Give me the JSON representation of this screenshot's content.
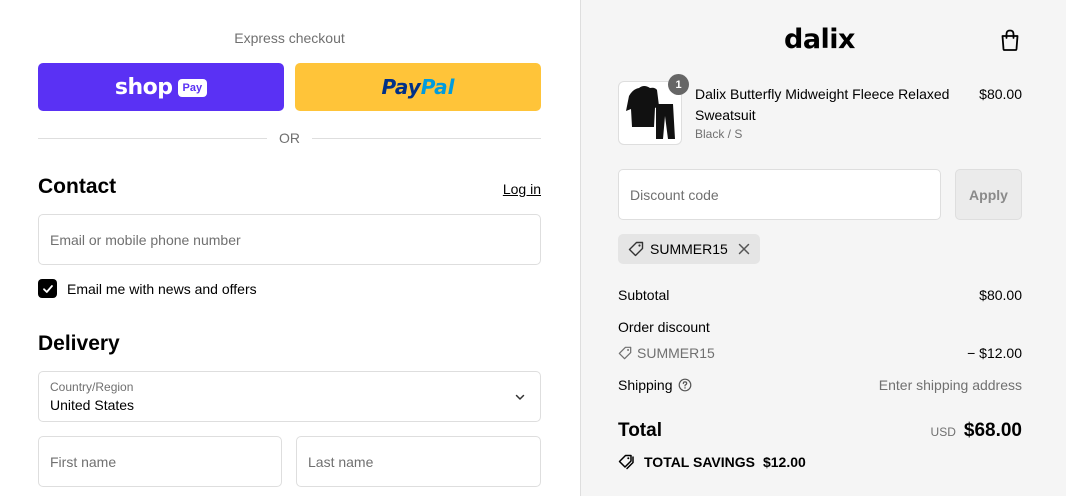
{
  "checkout": {
    "express_title": "Express checkout",
    "shop_pay": {
      "word": "shop",
      "badge": "Pay",
      "color": "#5a31f4"
    },
    "paypal": {
      "part1": "Pay",
      "part2": "Pal",
      "color": "#ffc439"
    },
    "or_text": "OR",
    "contact": {
      "heading": "Contact",
      "login_link": "Log in",
      "email_placeholder": "Email or mobile phone number",
      "newsletter_label": "Email me with news and offers",
      "newsletter_checked": true
    },
    "delivery": {
      "heading": "Delivery",
      "country_label": "Country/Region",
      "country_value": "United States",
      "first_name_placeholder": "First name",
      "last_name_placeholder": "Last name"
    }
  },
  "summary": {
    "brand": "dalix",
    "product": {
      "name": "Dalix Butterfly Midweight Fleece Relaxed Sweatsuit",
      "variant": "Black / S",
      "price": "$80.00",
      "quantity": "1"
    },
    "discount_placeholder": "Discount code",
    "apply_label": "Apply",
    "applied_code": "SUMMER15",
    "subtotal_label": "Subtotal",
    "subtotal_value": "$80.00",
    "order_discount_label": "Order discount",
    "discount_code": "SUMMER15",
    "discount_value": "− $12.00",
    "shipping_label": "Shipping",
    "shipping_value": "Enter shipping address",
    "total_label": "Total",
    "currency": "USD",
    "total_value": "$68.00",
    "savings_label": "TOTAL SAVINGS",
    "savings_value": "$12.00"
  }
}
